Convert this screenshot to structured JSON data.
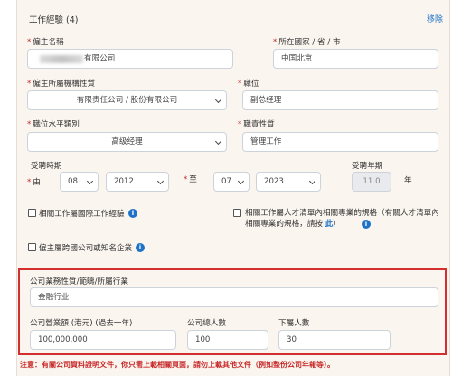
{
  "section": {
    "title": "工作經驗 (4)",
    "remove_label": "移除"
  },
  "employer_name": {
    "label": "僱主名稱",
    "value_tail": "有限公司"
  },
  "location": {
    "label": "所在國家 / 省 / 市",
    "value": "中国北京"
  },
  "institution_type": {
    "label": "僱主所屬機構性質",
    "value": "有限责任公司 / 股份有限公司"
  },
  "position": {
    "label": "職位",
    "value": "副总经理"
  },
  "position_level": {
    "label": "職位水平類別",
    "value": "高级经理"
  },
  "duty_nature": {
    "label": "職責性質",
    "value": "管理工作"
  },
  "period": {
    "label": "受聘時期",
    "from_label": "由",
    "from_month": "08",
    "from_year": "2012",
    "to_label": "至",
    "to_month": "07",
    "to_year": "2023"
  },
  "years": {
    "label": "受聘年期",
    "value": "11.0",
    "unit": "年"
  },
  "checks": {
    "intl_exp": "相關工作屬國際工作經驗",
    "talent_list": "相關工作屬人才清單內相關專業的規格（有關人才清單內相關專業的規格，請按",
    "talent_link": "此",
    "talent_end": "）",
    "multinational": "僱主屬跨國公司或知名企業"
  },
  "business": {
    "label": "公司業務性質/範疇/所屬行業",
    "value": "金融行业"
  },
  "revenue": {
    "label": "公司營業額 (港元) (過去一年)",
    "value": "100,000,000"
  },
  "staff_total": {
    "label": "公司總人數",
    "value": "100"
  },
  "subordinates": {
    "label": "下屬人數",
    "value": "30"
  },
  "note": "注意：有關公司資料證明文件，你只需上載相關頁面，請勿上載其他文件（例如整份公司年報等）。",
  "colors": {
    "accent": "#1e73c8",
    "required": "#c62828",
    "highlight_border": "#d32f2f",
    "card_bg": "#fbf5ef"
  }
}
